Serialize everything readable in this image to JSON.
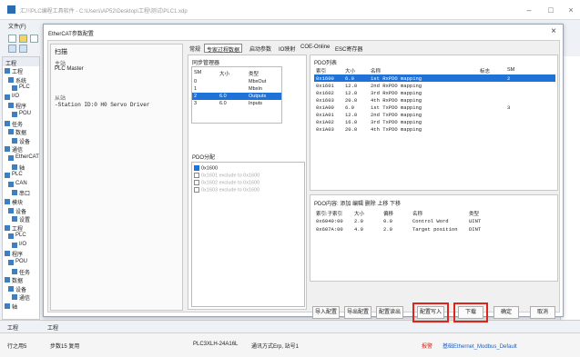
{
  "app": {
    "title": "汇川PLC编程工具软件 - C:\\Users\\AP52\\Desktop\\工程\\测试\\PLC1.xdp",
    "menu_file": "文件(F)",
    "menu_short": "工程"
  },
  "tree_items": [
    "工程",
    "系统",
    "PLC",
    "I/O",
    "程序",
    "POU",
    "任务",
    "数据",
    "设备",
    "通信",
    "EtherCAT",
    "轴",
    "PLC",
    "CAN",
    "串口",
    "模块",
    "设备",
    "设置",
    "工程",
    "PLC",
    "I/O",
    "程序",
    "POU",
    "任务",
    "数据",
    "设备",
    "通信",
    "轴"
  ],
  "dialog": {
    "title": "EtherCAT参数配置",
    "scan": {
      "title": "扫描",
      "master_label": "主站",
      "master_value": "PLC Master",
      "slave_label": "从站",
      "slave_value": "-Station ID:0 H0 Servo Driver"
    },
    "tabs": [
      "常规",
      "专家过程数据",
      "启动参数",
      "IO映射",
      "COE-Online",
      "ESC寄存器"
    ],
    "sync": {
      "title": "同步管理器",
      "headers": [
        "SM",
        "大小",
        "类型"
      ],
      "rows": [
        {
          "sm": "0",
          "size": "",
          "type": "MbxOut"
        },
        {
          "sm": "1",
          "size": "",
          "type": "MbxIn"
        },
        {
          "sm": "2",
          "size": "6.0",
          "type": "Outputs"
        },
        {
          "sm": "3",
          "size": "6.0",
          "type": "Inputs"
        }
      ],
      "selected_row": 2
    },
    "pdo_assign": {
      "title": "PDO分配",
      "rows": [
        {
          "label": "0x1600",
          "checked": true,
          "enabled": true
        },
        {
          "label": "0x1601 exclude to 0x1600",
          "checked": false,
          "enabled": false
        },
        {
          "label": "0x1602 exclude to 0x1600",
          "checked": false,
          "enabled": false
        },
        {
          "label": "0x1603 exclude to 0x1600",
          "checked": false,
          "enabled": false
        }
      ]
    },
    "pdo_list": {
      "title": "PDO列表",
      "headers": [
        "索引",
        "大小",
        "名称",
        "标志",
        "SM"
      ],
      "rows": [
        {
          "index": "0x1600",
          "size": "6.0",
          "name": "1st RxPDO mapping",
          "flag": "",
          "sm": "2"
        },
        {
          "index": "0x1601",
          "size": "12.0",
          "name": "2nd RxPDO mapping",
          "flag": "",
          "sm": ""
        },
        {
          "index": "0x1602",
          "size": "12.0",
          "name": "3rd RxPDO mapping",
          "flag": "",
          "sm": ""
        },
        {
          "index": "0x1603",
          "size": "20.0",
          "name": "4th RxPDO mapping",
          "flag": "",
          "sm": ""
        },
        {
          "index": "0x1A00",
          "size": "6.0",
          "name": "1st TxPDO mapping",
          "flag": "",
          "sm": "3"
        },
        {
          "index": "0x1A01",
          "size": "12.0",
          "name": "2nd TxPDO mapping",
          "flag": "",
          "sm": ""
        },
        {
          "index": "0x1A02",
          "size": "16.0",
          "name": "3rd TxPDO mapping",
          "flag": "",
          "sm": ""
        },
        {
          "index": "0x1A03",
          "size": "20.0",
          "name": "4th TxPDO mapping",
          "flag": "",
          "sm": ""
        }
      ],
      "selected_row": 0
    },
    "pdo_content": {
      "title": "PDO内容: 添加 编辑 删除 上移 下移",
      "headers": [
        "索引:子索引",
        "大小",
        "偏移",
        "名称",
        "类型"
      ],
      "rows": [
        {
          "index": "0x6040:00",
          "size": "2.0",
          "offset": "0.0",
          "name": "Control Word",
          "type": "UINT"
        },
        {
          "index": "0x607A:00",
          "size": "4.0",
          "offset": "2.0",
          "name": "Target position",
          "type": "DINT"
        }
      ]
    },
    "buttons": {
      "import": "导入配置",
      "export": "导出配置",
      "config_read": "配置读出",
      "config_write": "配置写入",
      "download": "下载",
      "ok": "确定",
      "cancel": "取消"
    },
    "highlight_color": "#e0241b"
  },
  "bottom_tabs": {
    "tab1": "工程",
    "tab2": "工程"
  },
  "status": {
    "row_col": "行之用5",
    "step": "步数15 复用",
    "plc_model": "PLC3XLH-24A16L",
    "mode": "通讯方式Erp, 站号1",
    "alarm": "报警",
    "protocol": "基础Ethernet_Modbus_Default"
  }
}
